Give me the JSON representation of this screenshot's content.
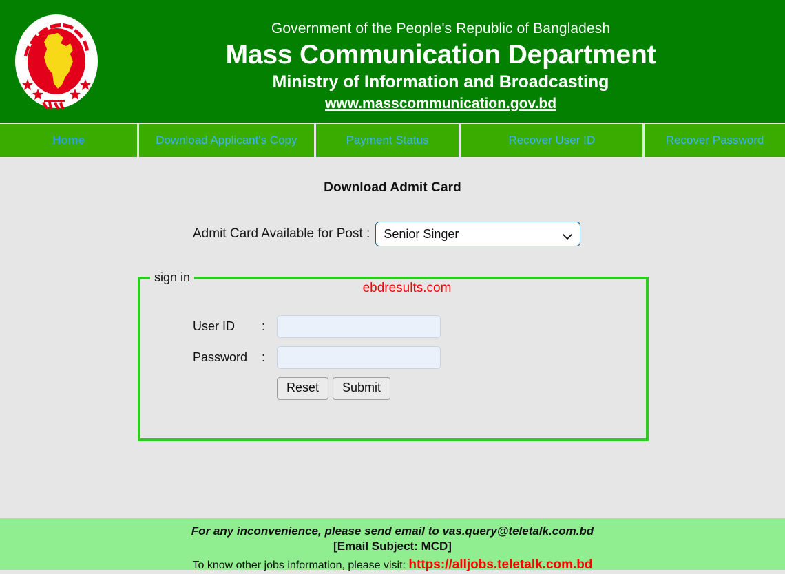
{
  "header": {
    "line1": "Government of the People's Republic of Bangladesh",
    "line2": "Mass Communication Department",
    "line3": "Ministry of Information and Broadcasting",
    "website": "www.masscommunication.gov.bd",
    "emblem_name": "bangladesh-government-emblem",
    "background_color": "#048000"
  },
  "nav": {
    "items": [
      {
        "label": "Home",
        "active": true
      },
      {
        "label": "Download Applicant's Copy",
        "active": false
      },
      {
        "label": "Payment Status",
        "active": false
      },
      {
        "label": "Recover User ID",
        "active": false
      },
      {
        "label": "Recover Password",
        "active": false
      }
    ],
    "background_color": "#3aac00",
    "text_color": "#3ab5f0"
  },
  "main": {
    "page_title": "Download Admit Card",
    "post_selector": {
      "label": "Admit Card Available for Post :",
      "selected_value": "Senior Singer",
      "options": [
        "Senior Singer"
      ]
    },
    "signin": {
      "legend": "sign in",
      "watermark": "ebdresults.com",
      "watermark_color": "#ff0000",
      "border_color": "#2ecc20",
      "fields": [
        {
          "label": "User ID",
          "separator": ":",
          "value": "",
          "placeholder": "",
          "type": "text"
        },
        {
          "label": "Password",
          "separator": ":",
          "value": "",
          "placeholder": "",
          "type": "password"
        }
      ],
      "buttons": [
        {
          "label": "Reset"
        },
        {
          "label": "Submit"
        }
      ]
    }
  },
  "footer": {
    "line1": "For any inconvenience, please send email to vas.query@teletalk.com.bd",
    "line2": "[Email Subject: MCD]",
    "line3_prefix": "To know other jobs information, please visit:",
    "link": "https://alljobs.teletalk.com.bd",
    "background_color": "#90ee90",
    "link_color": "#ff0000"
  }
}
